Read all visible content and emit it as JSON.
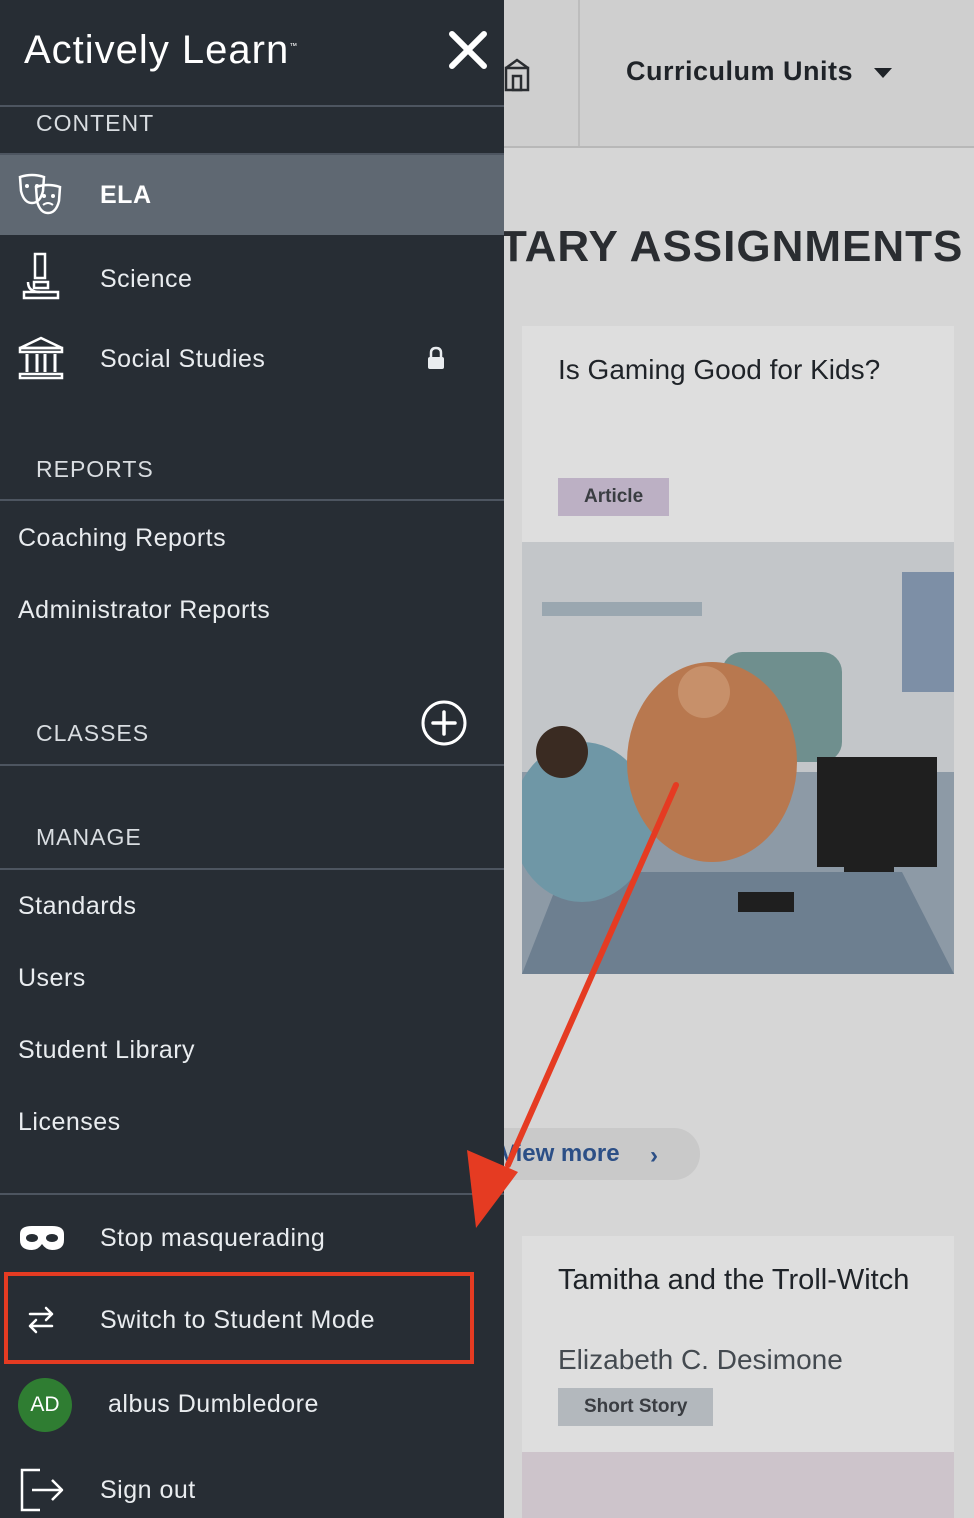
{
  "topbar": {
    "curriculum_label": "Curriculum Units"
  },
  "main": {
    "heading": "TARY ASSIGNMENTS",
    "cards": [
      {
        "title": "Is Gaming Good for Kids?",
        "tag": "Article"
      },
      {
        "title": "Tamitha and the Troll-Witch",
        "author": "Elizabeth C. Desimone",
        "tag": "Short Story"
      }
    ],
    "view_more": "View more"
  },
  "drawer": {
    "brand": "Actively Learn",
    "content_header": "CONTENT",
    "content_items": [
      {
        "label": "ELA",
        "icon": "theater-masks-icon",
        "active": true
      },
      {
        "label": "Science",
        "icon": "microscope-icon"
      },
      {
        "label": "Social Studies",
        "icon": "institution-icon",
        "locked": true
      }
    ],
    "reports_header": "REPORTS",
    "report_items": [
      "Coaching Reports",
      "Administrator Reports"
    ],
    "classes_header": "CLASSES",
    "manage_header": "MANAGE",
    "manage_items": [
      "Standards",
      "Users",
      "Student Library",
      "Licenses"
    ],
    "account": {
      "stop_masquerading": "Stop masquerading",
      "switch_mode": "Switch to Student Mode",
      "avatar_initials": "AD",
      "user_name": "albus Dumbledore",
      "sign_out": "Sign out"
    }
  },
  "annotation_color": "#e53b22"
}
